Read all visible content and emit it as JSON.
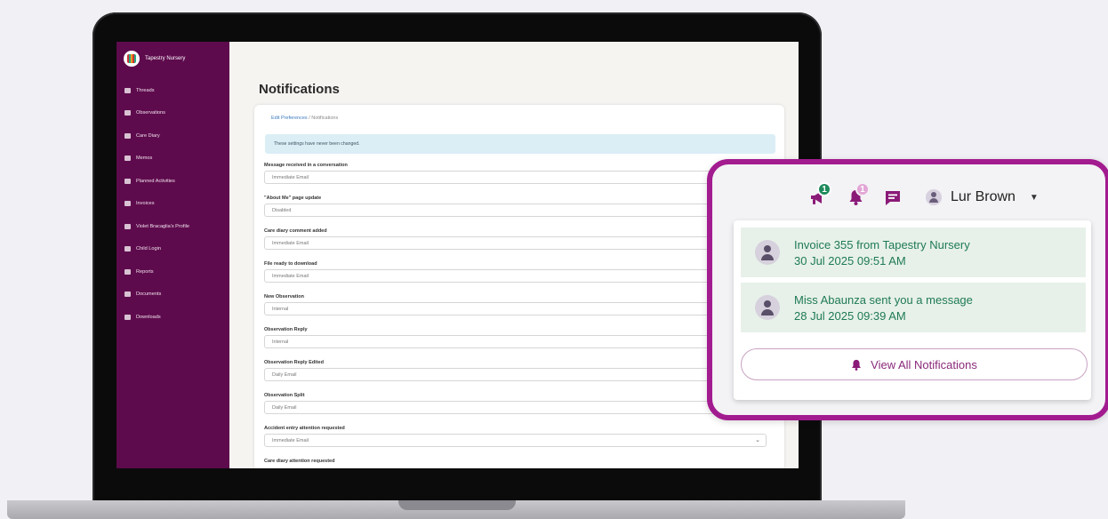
{
  "brand": {
    "name": "Tapestry Nursery"
  },
  "sidebar": {
    "items": [
      {
        "label": "Threads",
        "icon": "threads-icon"
      },
      {
        "label": "Observations",
        "icon": "search-icon"
      },
      {
        "label": "Care Diary",
        "icon": "care-diary-icon"
      },
      {
        "label": "Memos",
        "icon": "memo-icon"
      },
      {
        "label": "Planned Activities",
        "icon": "activities-icon"
      },
      {
        "label": "Invoices",
        "icon": "invoice-icon"
      },
      {
        "label": "Violet Bracaglia's Profile",
        "icon": "child-profile-icon"
      },
      {
        "label": "Child Login",
        "icon": "key-icon"
      },
      {
        "label": "Reports",
        "icon": "reports-icon"
      },
      {
        "label": "Documents",
        "icon": "folder-icon"
      },
      {
        "label": "Downloads",
        "icon": "download-icon"
      }
    ]
  },
  "main": {
    "title": "Notifications",
    "breadcrumb": {
      "link": "Edit Preferences",
      "separator": "/",
      "current": "Notifications"
    },
    "alert": "These settings have never been changed.",
    "settings": [
      {
        "label": "Message received in a conversation",
        "value": "Immediate Email"
      },
      {
        "label": "\"About Me\" page update",
        "value": "Disabled"
      },
      {
        "label": "Care diary comment added",
        "value": "Immediate Email"
      },
      {
        "label": "File ready to download",
        "value": "Immediate Email"
      },
      {
        "label": "New Observation",
        "value": "Internal"
      },
      {
        "label": "Observation Reply",
        "value": "Internal"
      },
      {
        "label": "Observation Reply Edited",
        "value": "Daily Email"
      },
      {
        "label": "Observation Split",
        "value": "Daily Email"
      },
      {
        "label": "Accident entry attention requested",
        "value": "Immediate Email"
      },
      {
        "label": "Care diary attention requested",
        "value": ""
      }
    ]
  },
  "popup": {
    "announcements_badge": "1",
    "notifications_badge": "1",
    "user_name": "Lur Brown",
    "notifications": [
      {
        "title": "Invoice 355 from Tapestry Nursery",
        "date": "30 Jul 2025 09:51 AM"
      },
      {
        "title": "Miss Abaunza sent you a message",
        "date": "28 Jul 2025 09:39 AM"
      }
    ],
    "view_all_label": "View All Notifications"
  },
  "colors": {
    "sidebar": "#5e0b4d",
    "popup_border": "#a21b8f",
    "notification_bg": "#e7f1e9",
    "notification_text": "#1f7a55",
    "badge_green": "#1e8a5c",
    "icon_purple": "#8a1a78"
  }
}
